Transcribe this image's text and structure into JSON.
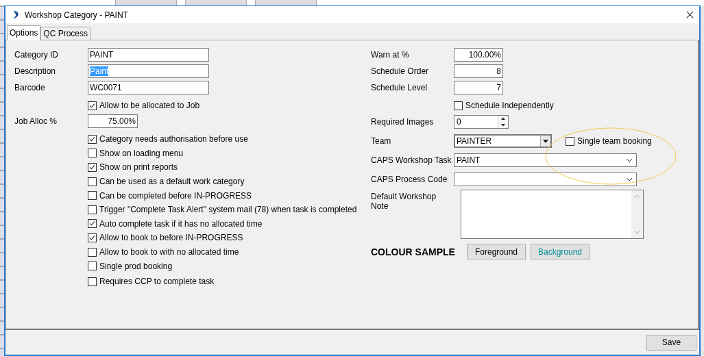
{
  "window": {
    "title": "Workshop Category - PAINT"
  },
  "tabs": [
    {
      "label": "Options",
      "selected": true
    },
    {
      "label": "QC Process",
      "selected": false
    }
  ],
  "left_fields": [
    {
      "label": "Category ID",
      "value": "PAINT",
      "selected": false
    },
    {
      "label": "Description",
      "value": "Paint",
      "selected": true
    },
    {
      "label": "Barcode",
      "value": "WC0071",
      "selected": false
    }
  ],
  "allocate_checkbox": {
    "label": "Allow to be allocated to Job",
    "checked": true
  },
  "job_alloc": {
    "label": "Job Alloc %",
    "value": "75.00%"
  },
  "options": [
    {
      "label": "Category needs authorisation before use",
      "checked": true
    },
    {
      "label": "Show on loading menu",
      "checked": false
    },
    {
      "label": "Show on print reports",
      "checked": true
    },
    {
      "label": "Can be used as a default work category",
      "checked": false
    },
    {
      "label": "Can be completed before IN-PROGRESS",
      "checked": false
    },
    {
      "label": "Trigger \"Complete Task Alert\" system mail (78) when task is completed",
      "checked": false
    },
    {
      "label": "Auto complete task if it has no allocated time",
      "checked": true
    },
    {
      "label": "Allow to book to before IN-PROGRESS",
      "checked": true
    },
    {
      "label": "Allow to book to with no allocated time",
      "checked": false
    },
    {
      "label": "Single prod booking",
      "checked": false
    },
    {
      "label": "Requires CCP to complete task",
      "checked": false
    }
  ],
  "right_fields": [
    {
      "label": "Warn at %",
      "value": "100.00%"
    },
    {
      "label": "Schedule Order",
      "value": "8"
    },
    {
      "label": "Schedule Level",
      "value": "7"
    }
  ],
  "schedule_independently": {
    "label": "Schedule Independently",
    "checked": false
  },
  "required_images": {
    "label": "Required Images",
    "value": "0"
  },
  "team": {
    "label": "Team",
    "value": "PAINTER"
  },
  "single_team_booking": {
    "label": "Single team booking",
    "checked": false
  },
  "caps_workshop_task": {
    "label": "CAPS Workshop Task",
    "value": "PAINT"
  },
  "caps_process_code": {
    "label": "CAPS Process Code"
  },
  "default_note": {
    "label": "Default Workshop Note"
  },
  "colour_sample": {
    "label": "COLOUR SAMPLE",
    "buttons": [
      {
        "label": "Foreground",
        "color": "#000000"
      },
      {
        "label": "Background",
        "color": "#008c95"
      }
    ]
  },
  "buttons": [
    "Save"
  ]
}
